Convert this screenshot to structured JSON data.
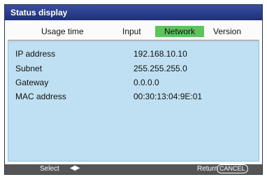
{
  "window": {
    "title": "Status display"
  },
  "tabs": [
    {
      "label": "Usage time",
      "active": false
    },
    {
      "label": "Input",
      "active": false
    },
    {
      "label": "Network",
      "active": true
    },
    {
      "label": "Version",
      "active": false
    }
  ],
  "network_info": [
    {
      "label": "IP address",
      "value": "192.168.10.10"
    },
    {
      "label": "Subnet",
      "value": "255.255.255.0"
    },
    {
      "label": "Gateway",
      "value": "0.0.0.0"
    },
    {
      "label": "MAC address",
      "value": "00:30:13:04:9E:01"
    }
  ],
  "footer": {
    "select_label": "Select",
    "return_label": "Return",
    "cancel_key_label": "CANCEL"
  },
  "colors": {
    "titlebar": "#2a3a8c",
    "active_tab": "#5cc45c",
    "panel": "#bfe0f2",
    "footer": "#555555"
  }
}
